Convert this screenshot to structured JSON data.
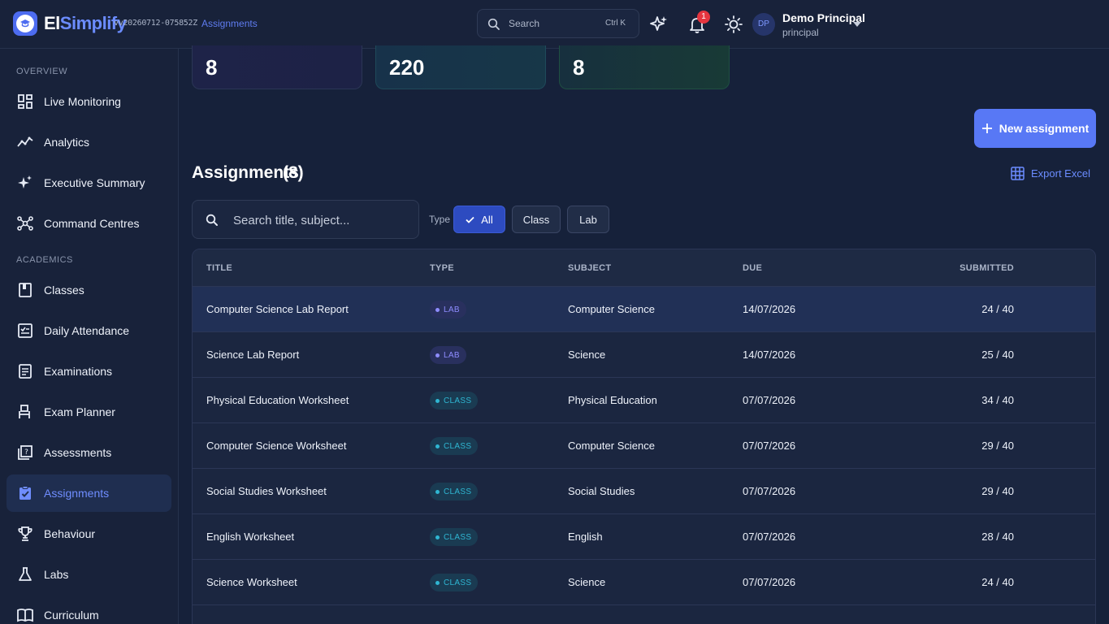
{
  "header": {
    "brand_part1": "El",
    "brand_part2": "Simplify",
    "version": "vv20260712-075852Z",
    "breadcrumb": "Assignments",
    "search_placeholder": "Search",
    "search_shortcut": "Ctrl K",
    "notification_count": "1",
    "user": {
      "initials": "DP",
      "name": "Demo Principal",
      "role": "principal"
    }
  },
  "sidebar": {
    "sections": [
      {
        "label": "OVERVIEW"
      },
      {
        "label": "ACADEMICS"
      }
    ],
    "items": [
      {
        "label": "Live Monitoring",
        "icon": "dashboard-icon"
      },
      {
        "label": "Analytics",
        "icon": "trend-icon"
      },
      {
        "label": "Executive Summary",
        "icon": "sparkle-icon"
      },
      {
        "label": "Command Centres",
        "icon": "hub-icon"
      },
      {
        "label": "Classes",
        "icon": "book-icon"
      },
      {
        "label": "Daily Attendance",
        "icon": "checklist-icon"
      },
      {
        "label": "Examinations",
        "icon": "document-icon"
      },
      {
        "label": "Exam Planner",
        "icon": "desk-icon"
      },
      {
        "label": "Assessments",
        "icon": "quiz-icon"
      },
      {
        "label": "Assignments",
        "icon": "clipboard-check-icon",
        "active": true
      },
      {
        "label": "Behaviour",
        "icon": "trophy-icon"
      },
      {
        "label": "Labs",
        "icon": "flask-icon"
      },
      {
        "label": "Curriculum",
        "icon": "open-book-icon"
      }
    ]
  },
  "stats": [
    {
      "value": "8"
    },
    {
      "value": "220"
    },
    {
      "value": "8"
    }
  ],
  "main": {
    "new_button": "New assignment",
    "title": "Assignments",
    "count": "(8)",
    "export_label": "Export Excel",
    "search_placeholder": "Search title, subject...",
    "type_label": "Type",
    "filters": [
      {
        "label": "All",
        "active": true
      },
      {
        "label": "Class"
      },
      {
        "label": "Lab"
      }
    ]
  },
  "table": {
    "columns": [
      "TITLE",
      "TYPE",
      "SUBJECT",
      "DUE",
      "SUBMITTED"
    ],
    "rows": [
      {
        "title": "Computer Science Lab Report",
        "type": "LAB",
        "subject": "Computer Science",
        "due": "14/07/2026",
        "submitted": "24 / 40"
      },
      {
        "title": "Science Lab Report",
        "type": "LAB",
        "subject": "Science",
        "due": "14/07/2026",
        "submitted": "25 / 40"
      },
      {
        "title": "Physical Education Worksheet",
        "type": "CLASS",
        "subject": "Physical Education",
        "due": "07/07/2026",
        "submitted": "34 / 40"
      },
      {
        "title": "Computer Science Worksheet",
        "type": "CLASS",
        "subject": "Computer Science",
        "due": "07/07/2026",
        "submitted": "29 / 40"
      },
      {
        "title": "Social Studies Worksheet",
        "type": "CLASS",
        "subject": "Social Studies",
        "due": "07/07/2026",
        "submitted": "29 / 40"
      },
      {
        "title": "English Worksheet",
        "type": "CLASS",
        "subject": "English",
        "due": "07/07/2026",
        "submitted": "28 / 40"
      },
      {
        "title": "Science Worksheet",
        "type": "CLASS",
        "subject": "Science",
        "due": "07/07/2026",
        "submitted": "24 / 40"
      }
    ]
  },
  "colors": {
    "accent": "#5878f5",
    "background": "#16213a",
    "lab_badge": "#8e8cff",
    "class_badge": "#2fb6d2",
    "notification": "#e5353f"
  }
}
